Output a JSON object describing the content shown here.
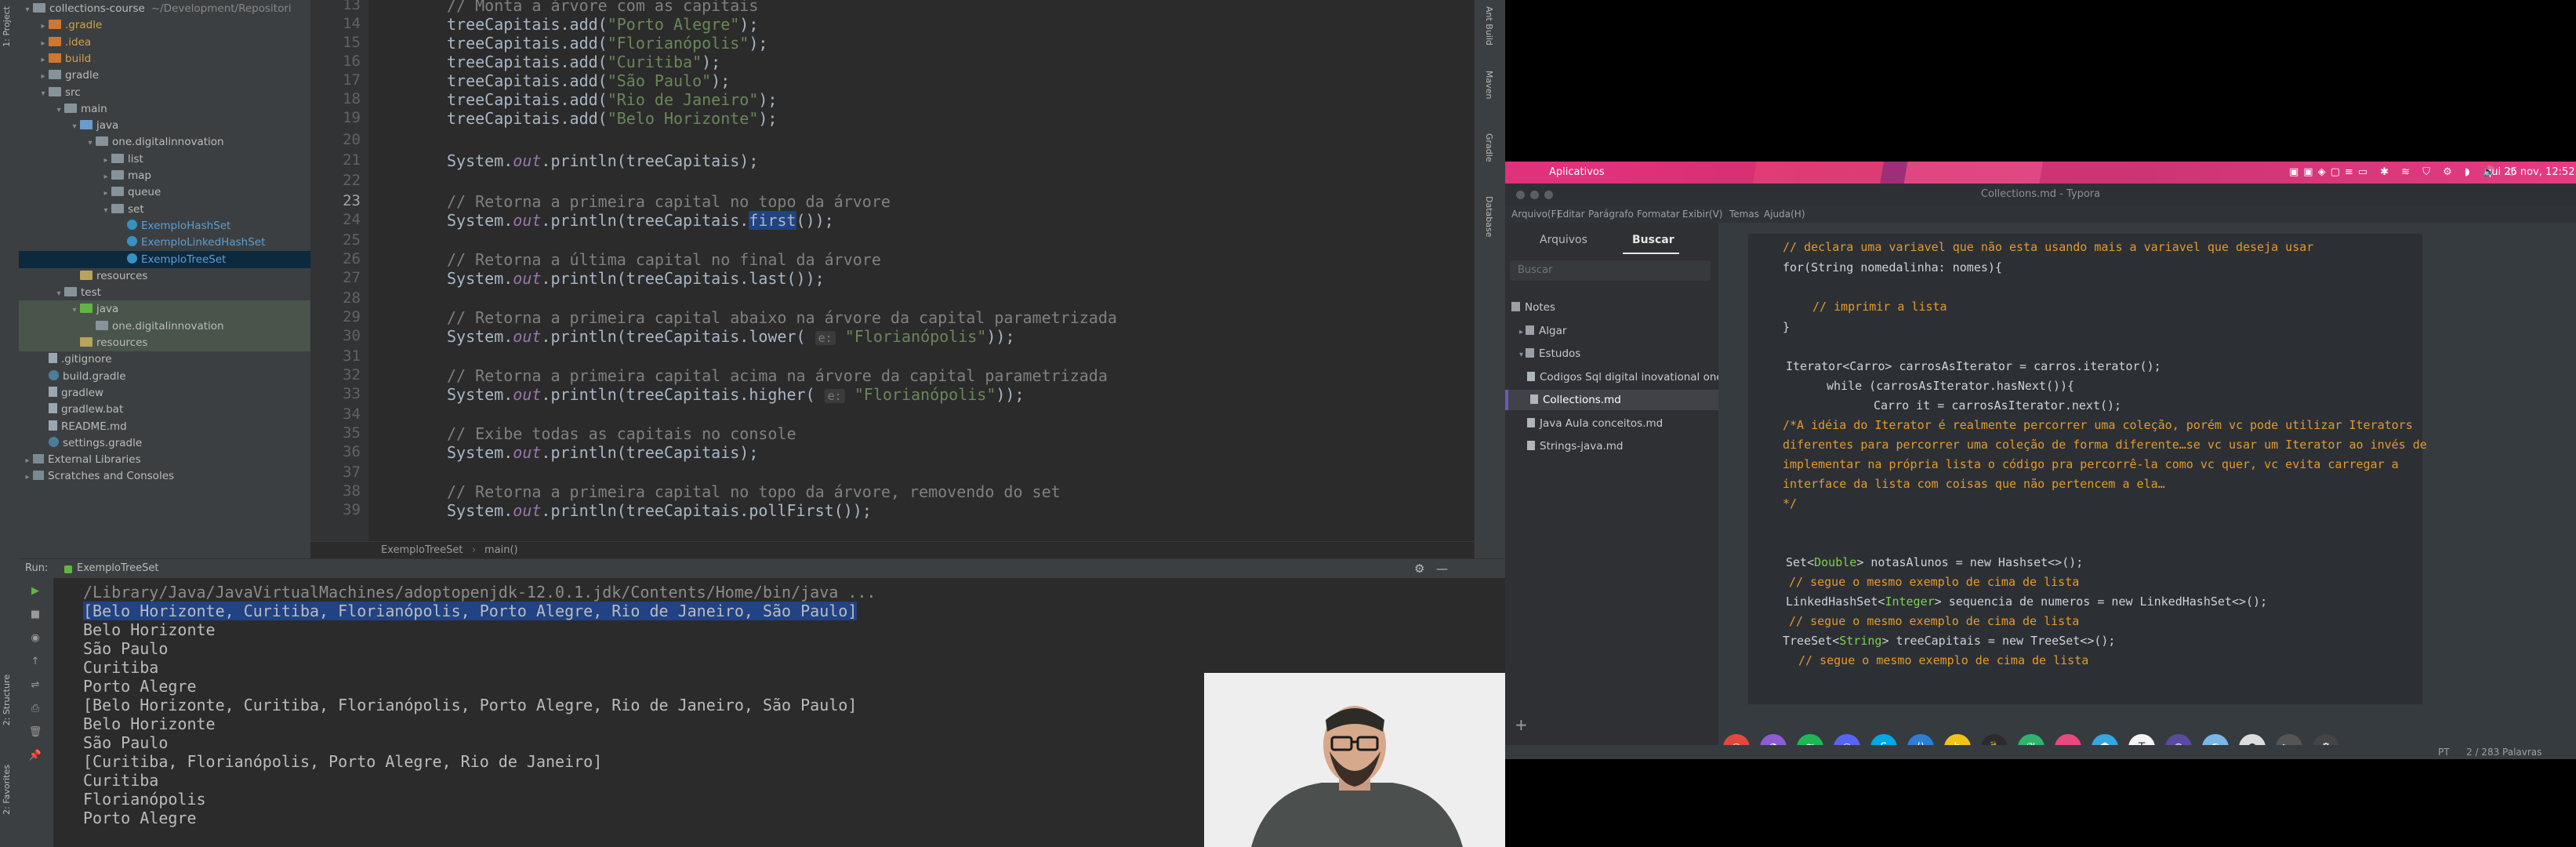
{
  "ide": {
    "left_strip": {
      "project_label": "1: Project",
      "structure_label": "2: Structure",
      "favorites_label": "2: Favorites"
    },
    "right_strip": {
      "ant_label": "Ant Build",
      "maven_label": "Maven",
      "gradle_label": "Gradle",
      "database_label": "Database"
    },
    "project_tree": [
      {
        "label": "collections-course",
        "suffix": "~/Development/Repositori",
        "depth": 0,
        "type": "folder",
        "twisty": "▾"
      },
      {
        "label": ".gradle",
        "depth": 1,
        "type": "folder-excl",
        "twisty": "▸",
        "color": "#d0a34a"
      },
      {
        "label": ".idea",
        "depth": 1,
        "type": "folder-excl",
        "twisty": "▸",
        "color": "#d0a34a"
      },
      {
        "label": "build",
        "depth": 1,
        "type": "folder-excl",
        "twisty": "▸",
        "color": "#d0a34a"
      },
      {
        "label": "gradle",
        "depth": 1,
        "type": "folder",
        "twisty": "▸"
      },
      {
        "label": "src",
        "depth": 1,
        "type": "folder",
        "twisty": "▾"
      },
      {
        "label": "main",
        "depth": 2,
        "type": "folder",
        "twisty": "▾"
      },
      {
        "label": "java",
        "depth": 3,
        "type": "folder-src",
        "twisty": "▾"
      },
      {
        "label": "one.digitalinnovation",
        "depth": 4,
        "type": "pkg",
        "twisty": "▾"
      },
      {
        "label": "list",
        "depth": 5,
        "type": "pkg",
        "twisty": "▸"
      },
      {
        "label": "map",
        "depth": 5,
        "type": "pkg",
        "twisty": "▸"
      },
      {
        "label": "queue",
        "depth": 5,
        "type": "pkg",
        "twisty": "▸"
      },
      {
        "label": "set",
        "depth": 5,
        "type": "pkg",
        "twisty": "▾"
      },
      {
        "label": "ExemploHashSet",
        "depth": 6,
        "type": "cls",
        "twisty": "",
        "color": "#5c9fd6"
      },
      {
        "label": "ExemploLinkedHashSet",
        "depth": 6,
        "type": "cls",
        "twisty": "",
        "color": "#5c9fd6"
      },
      {
        "label": "ExemploTreeSet",
        "depth": 6,
        "type": "cls",
        "twisty": "",
        "color": "#5c9fd6",
        "selected": true
      },
      {
        "label": "resources",
        "depth": 3,
        "type": "folder-res",
        "twisty": ""
      },
      {
        "label": "test",
        "depth": 2,
        "type": "folder",
        "twisty": "▾"
      },
      {
        "label": "java",
        "depth": 3,
        "type": "folder-test",
        "twisty": "▾",
        "hl": true
      },
      {
        "label": "one.digitalinnovation",
        "depth": 4,
        "type": "pkg",
        "twisty": "",
        "hl": true
      },
      {
        "label": "resources",
        "depth": 3,
        "type": "folder-res",
        "twisty": "",
        "hl": true
      },
      {
        "label": ".gitignore",
        "depth": 1,
        "type": "file",
        "twisty": ""
      },
      {
        "label": "build.gradle",
        "depth": 1,
        "type": "gradle",
        "twisty": ""
      },
      {
        "label": "gradlew",
        "depth": 1,
        "type": "file",
        "twisty": ""
      },
      {
        "label": "gradlew.bat",
        "depth": 1,
        "type": "file",
        "twisty": ""
      },
      {
        "label": "README.md",
        "depth": 1,
        "type": "file",
        "twisty": ""
      },
      {
        "label": "settings.gradle",
        "depth": 1,
        "type": "gradle",
        "twisty": ""
      },
      {
        "label": "External Libraries",
        "depth": 0,
        "type": "lib",
        "twisty": "▸"
      },
      {
        "label": "Scratches and Consoles",
        "depth": 0,
        "type": "lib",
        "twisty": "▸"
      }
    ],
    "line_numbers": [
      "13",
      "14",
      "15",
      "16",
      "17",
      "18",
      "19",
      "20",
      "21",
      "22",
      "23",
      "24",
      "25",
      "26",
      "27",
      "28",
      "29",
      "30",
      "31",
      "32",
      "33",
      "34",
      "35",
      "36",
      "37",
      "38",
      "39"
    ],
    "current_line": "23",
    "code": {
      "l13": "// Monta a árvore com as capitais",
      "l14": "Porto Alegre",
      "l15": "Florianópolis",
      "l16": "Curitiba",
      "l17": "São Paulo",
      "l18": "Rio de Janeiro",
      "l19": "Belo Horizonte",
      "l20": "System.out.println(treeCapitais);",
      "l22": "// Retorna a primeira capital no topo da árvore",
      "l25": "// Retorna a última capital no final da árvore",
      "l28": "// Retorna a primeira capital abaixo na árvore da capital parametrizada",
      "l31": "// Retorna a primeira capital acima na árvore da capital parametrizada",
      "l34": "// Exibe todas as capitais no console",
      "l37": "// Retorna a primeira capital no topo da árvore, removendo do set",
      "hint_param": "e:",
      "param_str": "\"Florianópolis\""
    },
    "breadcrumb": {
      "class": "ExemploTreeSet",
      "method": "main()"
    },
    "run": {
      "label": "Run:",
      "tab": "ExemploTreeSet",
      "command": "/Library/Java/JavaVirtualMachines/adoptopenjdk-12.0.1.jdk/Contents/Home/bin/java ...",
      "lines": [
        "[Belo Horizonte, Curitiba, Florianópolis, Porto Alegre, Rio de Janeiro, São Paulo]",
        "Belo Horizonte",
        "São Paulo",
        "Curitiba",
        "Porto Alegre",
        "[Belo Horizonte, Curitiba, Florianópolis, Porto Alegre, Rio de Janeiro, São Paulo]",
        "Belo Horizonte",
        "São Paulo",
        "[Curitiba, Florianópolis, Porto Alegre, Rio de Janeiro]",
        "Curitiba",
        "Florianópolis",
        "Porto Alegre"
      ]
    }
  },
  "topbar": {
    "app_menu": "Aplicativos",
    "datetime": "qui 26 nov, 12:52"
  },
  "typora": {
    "title": "Collections.md - Typora",
    "menu": [
      "Arquivo(F)",
      "Editar",
      "Parágrafo",
      "Formatar",
      "Exibir(V)",
      "Temas",
      "Ajuda(H)"
    ],
    "tabs": {
      "files": "Arquivos",
      "search": "Buscar"
    },
    "search_placeholder": "Buscar",
    "files": [
      {
        "label": "Notes",
        "depth": 0,
        "type": "folder",
        "twisty": ""
      },
      {
        "label": "Algar",
        "depth": 1,
        "type": "folder",
        "twisty": "▸"
      },
      {
        "label": "Estudos",
        "depth": 1,
        "type": "folder",
        "twisty": "▾"
      },
      {
        "label": "Codigos Sql digital inovational one",
        "depth": 2,
        "type": "doc"
      },
      {
        "label": "Collections.md",
        "depth": 2,
        "type": "doc",
        "active": true
      },
      {
        "label": "Java Aula conceitos.md",
        "depth": 2,
        "type": "doc"
      },
      {
        "label": "Strings-java.md",
        "depth": 2,
        "type": "doc"
      }
    ],
    "code": {
      "c1": "// declara uma variavel que não esta usando mais a variavel que deseja usar",
      "c2": "for(String nomedalinha: nomes){",
      "c3": "// imprimir a lista",
      "c4": "}",
      "c5": "Iterator<Carro> carrosAsIterator = carros.iterator();",
      "c6": "while (carrosAsIterator.hasNext()){",
      "c7": "Carro it = carrosAsIterator.next();",
      "c8": "/*A idéia do Iterator é realmente percorrer uma coleção, porém vc pode utilizar Iterators",
      "c9": "diferentes para percorrer uma coleção de forma diferente…se vc usar um Iterator ao invés de",
      "c10": "implementar na própria lista o código pra percorrê-la como vc quer, vc evita carregar a",
      "c11": "interface da lista com coisas que não pertencem a ela…",
      "c12": "*/",
      "c13a": "Set<",
      "c13b": "Double",
      "c13c": "> notasAlunos = new Hashset<>();",
      "c14": "// segue o mesmo exemplo de cima de lista",
      "c15a": "LinkedHashSet<",
      "c15b": "Integer",
      "c15c": "> sequencia de numeros = new LinkedHashSet<>();",
      "c16": "// segue o mesmo exemplo de cima de lista",
      "c17a": "TreeSet<",
      "c17b": "String",
      "c17c": "> treeCapitais = new TreeSet<>();",
      "c18": "// segue o mesmo exemplo de cima de lista"
    },
    "status": {
      "lang": "PT",
      "words": "2 / 283 Palavras"
    }
  },
  "dock": [
    "chrome-icon",
    "twitch-icon",
    "spotify-icon",
    "discord-icon",
    "skype-icon",
    "vscode-icon",
    "bitdefender-icon",
    "tux-icon",
    "greenleaf-icon",
    "jetbrains-icon",
    "hex-icon",
    "typora-icon",
    "obs-icon",
    "nautilus-icon",
    "bubble-icon",
    "terminal-icon",
    "settings-icon"
  ]
}
